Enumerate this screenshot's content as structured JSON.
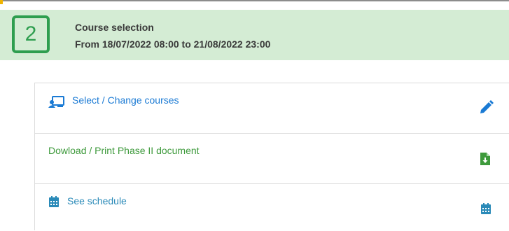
{
  "step": {
    "number": "2",
    "title": "Course selection",
    "dates": "From 18/07/2022 08:00 to 21/08/2022 23:00"
  },
  "actions": [
    {
      "label": "Select / Change courses",
      "left_icon": "presentation-icon",
      "right_icon": "pencil-icon",
      "color": "#1a7ad4"
    },
    {
      "label": "Dowload / Print Phase II document",
      "right_icon": "file-download-icon",
      "color": "#3e9a3c"
    },
    {
      "label": "See schedule",
      "left_icon": "calendar-icon",
      "right_icon": "calendar-icon",
      "color": "#2a8ab8"
    }
  ],
  "colors": {
    "banner_bg": "#d4ecd4",
    "badge_green": "#2e9e4f",
    "link_blue": "#1a7ad4",
    "download_green": "#3e9a3c",
    "schedule_teal": "#2a8ab8"
  }
}
